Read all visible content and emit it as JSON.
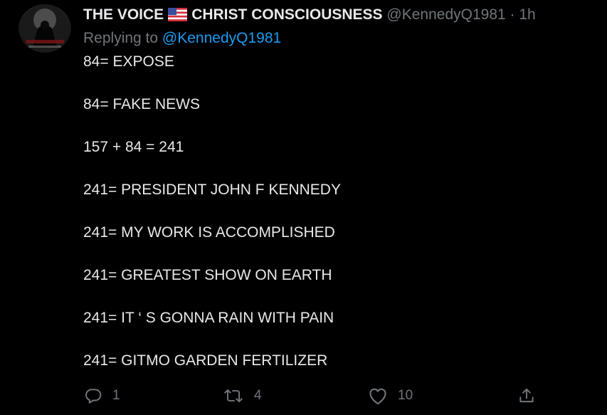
{
  "author": {
    "display_name": "THE VOICE",
    "display_name_suffix": "CHRIST CONSCIOUSNESS",
    "flag_icon": "us-flag-icon",
    "handle": "@KennedyQ1981",
    "separator": "·",
    "time": "1h"
  },
  "reply": {
    "prefix": "Replying to ",
    "mention": "@KennedyQ1981"
  },
  "lines": [
    "84= EXPOSE",
    "84= FAKE NEWS",
    "157 + 84 = 241",
    "241= PRESIDENT JOHN F KENNEDY",
    "241= MY WORK IS ACCOMPLISHED",
    "241= GREATEST SHOW ON EARTH",
    "241= IT ‘ S GONNA RAIN WITH PAIN",
    "241= GITMO GARDEN FERTILIZER"
  ],
  "actions": {
    "reply": {
      "icon": "reply-icon",
      "count": "1"
    },
    "retweet": {
      "icon": "retweet-icon",
      "count": "4"
    },
    "like": {
      "icon": "heart-icon",
      "count": "10"
    },
    "share": {
      "icon": "share-icon"
    }
  },
  "colors": {
    "background": "#000000",
    "text": "#e7e9ea",
    "muted": "#71767b",
    "accent": "#1d9bf0"
  }
}
